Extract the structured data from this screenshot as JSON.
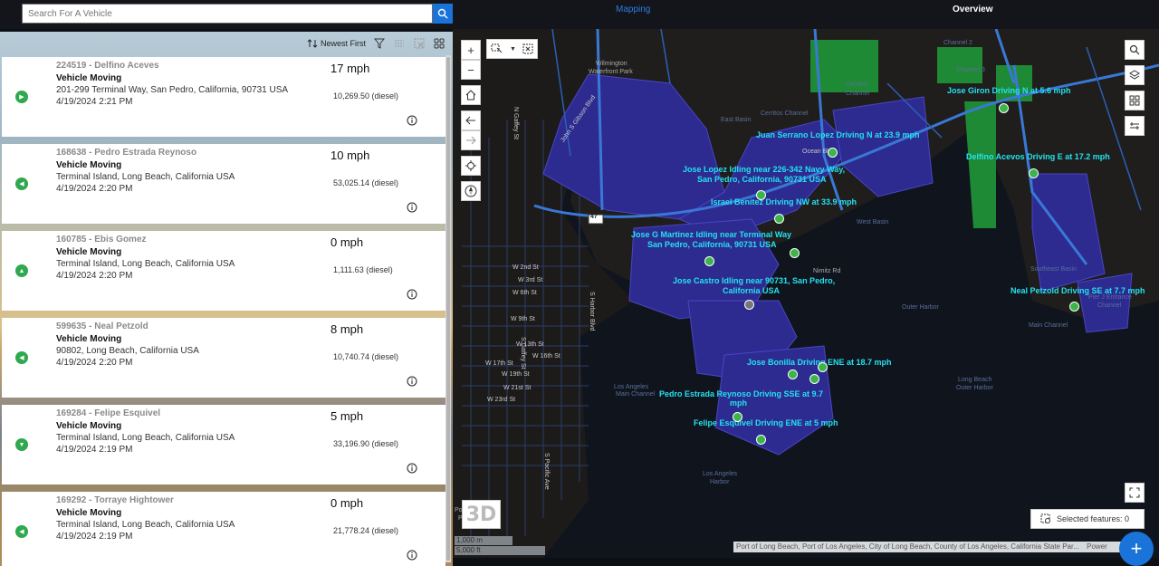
{
  "search": {
    "placeholder": "Search For A Vehicle"
  },
  "nav": {
    "mapping": "Mapping",
    "overview": "Overview"
  },
  "toolbar": {
    "sort_label": "Newest First"
  },
  "vehicles": [
    {
      "id": "224519",
      "sep": " - ",
      "name": "Delfino Aceves",
      "status": "Vehicle Moving",
      "address": "201-299 Terminal Way, San Pedro, California, 90731 USA",
      "time": "4/19/2024 2:21 PM",
      "speed": "17  mph",
      "odometer": "10,269.50  (diesel)",
      "arrow": "▶"
    },
    {
      "id": "168638",
      "sep": " - ",
      "name": "Pedro Estrada Reynoso",
      "status": "Vehicle Moving",
      "address": "Terminal Island, Long Beach, California USA",
      "time": "4/19/2024 2:20 PM",
      "speed": "10  mph",
      "odometer": "53,025.14  (diesel)",
      "arrow": "◀"
    },
    {
      "id": "160785",
      "sep": " - ",
      "name": "Ebis Gomez",
      "status": "Vehicle Moving",
      "address": "Terminal Island, Long Beach, California USA",
      "time": "4/19/2024 2:20 PM",
      "speed": "0  mph",
      "odometer": "1,111.63  (diesel)",
      "arrow": "▲"
    },
    {
      "id": "599635",
      "sep": " - ",
      "name": "Neal Petzold",
      "status": "Vehicle Moving",
      "address": "90802, Long Beach, California USA",
      "time": "4/19/2024 2:20 PM",
      "speed": "8  mph",
      "odometer": "10,740.74  (diesel)",
      "arrow": "◀"
    },
    {
      "id": "169284",
      "sep": " - ",
      "name": "Felipe Esquivel",
      "status": "Vehicle Moving",
      "address": "Terminal Island, Long Beach, California USA",
      "time": "4/19/2024 2:19 PM",
      "speed": "5  mph",
      "odometer": "33,196.90  (diesel)",
      "arrow": "▼"
    },
    {
      "id": "169292",
      "sep": " - ",
      "name": "Torraye Hightower",
      "status": "Vehicle Moving",
      "address": "Terminal Island, Long Beach, California USA",
      "time": "4/19/2024 2:19 PM",
      "speed": "0  mph",
      "odometer": "21,778.24  (diesel)",
      "arrow": "◀"
    }
  ],
  "map": {
    "vehicle_labels": [
      "Jose Giron Driving N at 5.6 mph",
      "Juan Serrano Lopez Driving N at 23.9 mph",
      "Delfino Acevos Driving E at 17.2 mph",
      "Jose Lopez Idling near 226-342 Navy Way,",
      "San Pedro, California, 90731 USA",
      "Israel Benitez Driving NW at 33.9 mph",
      "Jose G Martinez Idling near Terminal Way",
      "San Pedro, California, 90731 USA",
      "Jose Castro Idling near 90731, San Pedro,",
      "California USA",
      "Neal Petzold Driving SE at 7.7 mph",
      "Jose Bonilla Driving ENE at 18.7 mph",
      "Pedro Estrada Reynoso Driving SSE at 9.7",
      "mph",
      "Felipe Esquivel Driving ENE at 5 mph"
    ],
    "places": [
      "Cerritos",
      "Channel",
      "Channel 2",
      "Channel 3",
      "East Basin",
      "Cerritos Channel",
      "West Basin",
      "Outer Harbor",
      "Long Beach",
      "Outer Harbor",
      "Southeast Basin",
      "Main Channel",
      "Pier J Entrance",
      "Channel",
      "Los Angeles",
      "Main Channel",
      "Los Angeles",
      "Harbor",
      "Wilmington",
      "Waterfront Park",
      "Point Fermin",
      "Park",
      "Nimitz Rd"
    ],
    "streets": [
      "W 2nd St",
      "W 3rd St",
      "W 6th St",
      "W 9th St",
      "W 13th St",
      "W 16th St",
      "W 17th St",
      "W 19th St",
      "W 21st St",
      "W 23rd St",
      "S Pacific Ave",
      "S Gaffey St",
      "N Gaffey St",
      "John S Gibson Blvd",
      "S Harbor Blvd",
      "Ocean Blvd"
    ],
    "scale_m": "1,000 m",
    "scale_ft": "5,000 ft",
    "attribution": "Port of Long Beach, Port of Los Angeles, City of Long Beach, County of Los Angeles, California State Par...",
    "powered": "Power",
    "selected_features": "Selected features: 0",
    "three_d": "3D",
    "highway": "47"
  },
  "colors": {
    "accent": "#1a73d9",
    "label": "#24e1f0",
    "terminal": "#2d2b8f",
    "green": "#2fa84f"
  }
}
